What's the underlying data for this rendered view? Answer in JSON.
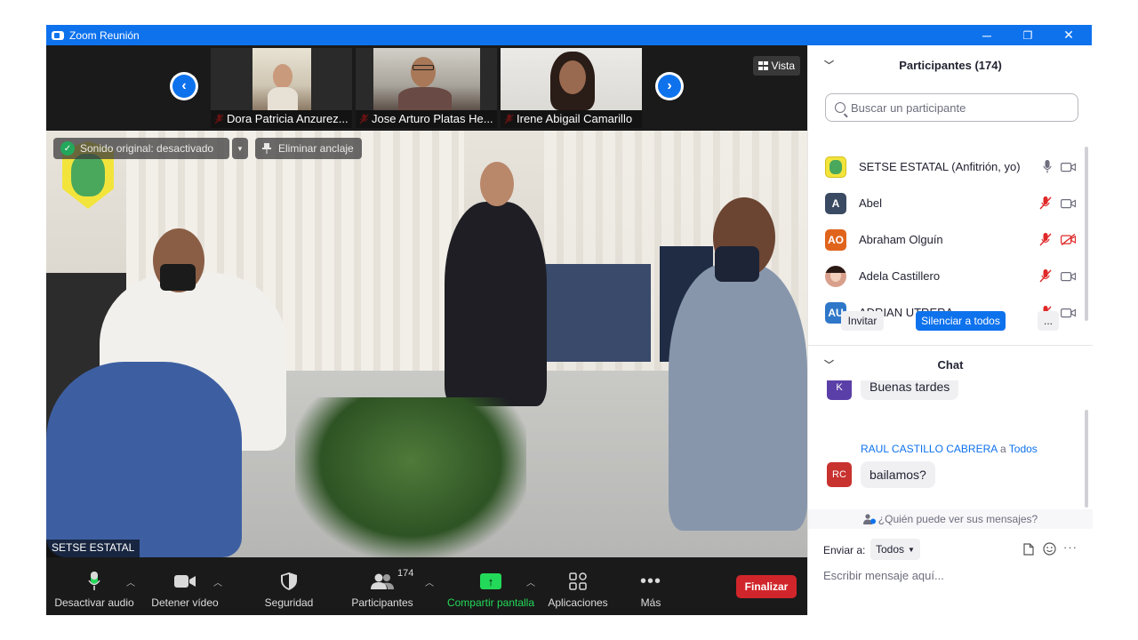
{
  "window": {
    "title": "Zoom Reunión",
    "controls": {
      "minimize": "─",
      "restore": "❐",
      "close": "✕"
    }
  },
  "strip": {
    "thumbnails": [
      {
        "name": "Dora Patricia Anzurez...",
        "muted": true
      },
      {
        "name": "Jose Arturo Platas He...",
        "muted": true
      },
      {
        "name": "Irene Abigail Camarillo",
        "muted": true
      }
    ],
    "prev_icon": "‹",
    "next_icon": "›",
    "view_label": "Vista"
  },
  "main_video": {
    "original_sound": "Sonido original: desactivado",
    "unpin": "Eliminar anclaje",
    "speaker": "SETSE ESTATAL"
  },
  "toolbar": {
    "mute": "Desactivar audio",
    "video": "Detener vídeo",
    "security": "Seguridad",
    "participants": "Participantes",
    "participants_count": "174",
    "share": "Compartir pantalla",
    "apps": "Aplicaciones",
    "more": "Más",
    "end": "Finalizar",
    "share_color": "#23d959",
    "end_color": "#d0262b"
  },
  "participants": {
    "title": "Participantes (174)",
    "search_placeholder": "Buscar un participante",
    "list": [
      {
        "initials": "",
        "name": "SETSE ESTATAL (Anfitrión, yo)",
        "color": "#f3e43c",
        "mic": "on",
        "video": "on"
      },
      {
        "initials": "A",
        "name": "Abel",
        "color": "#3a4a63",
        "mic": "off",
        "video": "on"
      },
      {
        "initials": "AO",
        "name": "Abraham Olguín",
        "color": "#e0641c",
        "mic": "off",
        "video": "off"
      },
      {
        "initials": "",
        "name": "Adela Castillero",
        "color": "#d8a08c",
        "mic": "off",
        "video": "on"
      },
      {
        "initials": "AU",
        "name": "ADRIAN UTRERA",
        "color": "#2f77c9",
        "mic": "off",
        "video": "on"
      }
    ],
    "invite": "Invitar",
    "mute_all": "Silenciar a todos",
    "more": "..."
  },
  "chat": {
    "title": "Chat",
    "messages": [
      {
        "initials": "K",
        "avatar_color": "#5b3fa8",
        "text": "Buenas tardes"
      },
      {
        "initials": "RC",
        "avatar_color": "#c8322f",
        "sender": "RAUL CASTILLO CABRERA",
        "to_word": "a",
        "recipient": "Todos",
        "text": "bailamos?"
      }
    ],
    "visibility": "¿Quién puede ver sus mensajes?",
    "send_to_label": "Enviar a:",
    "send_to_value": "Todos",
    "input_placeholder": "Escribir mensaje aquí..."
  }
}
